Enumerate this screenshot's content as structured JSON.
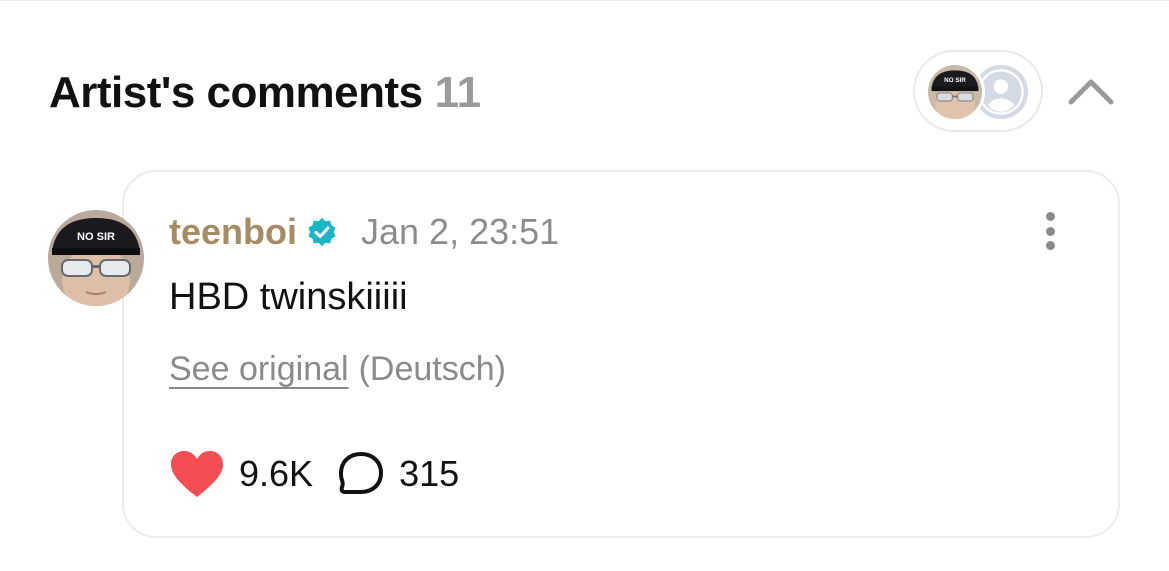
{
  "section": {
    "title": "Artist's comments",
    "count": "11"
  },
  "header_controls": {
    "avatar_stack_icons": [
      "artist-avatar",
      "default-user-avatar"
    ],
    "collapse_icon": "chevron-up-icon"
  },
  "comment": {
    "username": "teenboi",
    "verified_icon": "verified-badge-icon",
    "timestamp": "Jan 2, 23:51",
    "text": "HBD twinskiiiii",
    "see_original_label": "See original",
    "language_label": "(Deutsch)",
    "likes": "9.6K",
    "replies": "315",
    "avatar_cap_text": "NO SIR",
    "colors": {
      "username": "#a58c62",
      "verified": "#1ab6c7",
      "heart": "#f44d52",
      "muted": "#8a8a8a"
    }
  }
}
